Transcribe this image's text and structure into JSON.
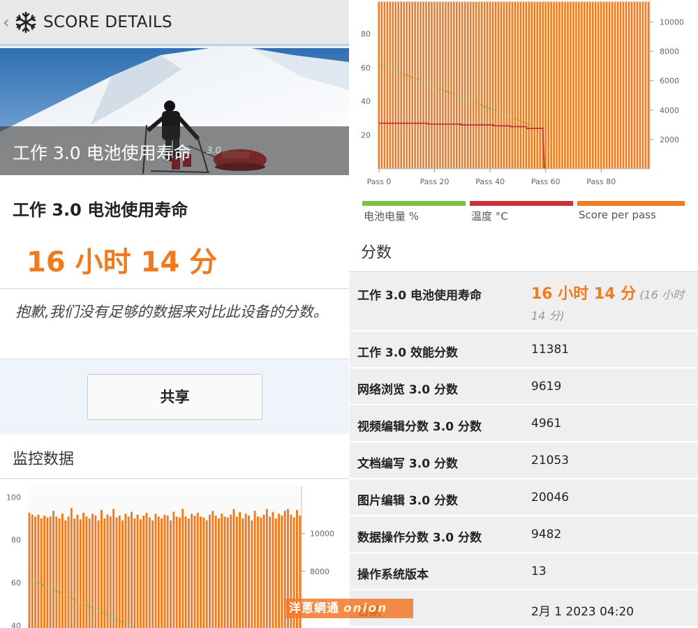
{
  "topbar": {
    "back_icon": "chevron-left-icon",
    "logo_icon": "snowflake-icon",
    "title": "SCORE DETAILS"
  },
  "hero": {
    "title": "工作 3.0 电池使用寿命",
    "version": "3.0"
  },
  "result": {
    "title": "工作 3.0 电池使用寿命",
    "value": "16 小时 14 分"
  },
  "message": "抱歉,我们没有足够的数据来对比此设备的分数。",
  "share_label": "共享",
  "monitoring": {
    "title": "监控数据"
  },
  "legend": [
    {
      "label": "电池电量 %",
      "color": "#7cc242"
    },
    {
      "label": "温度 °C",
      "color": "#c8323a"
    },
    {
      "label": "Score per pass",
      "color": "#f07b1f"
    }
  ],
  "scores": {
    "title": "分数",
    "rows": [
      {
        "label": "工作 3.0 电池使用寿命",
        "value": "16 小时 14 分",
        "sub": "(16 小时 14 分)"
      },
      {
        "label": "工作 3.0 效能分数",
        "value": "11381"
      },
      {
        "label": "网络浏览 3.0 分数",
        "value": "9619"
      },
      {
        "label": "视频编辑分数 3.0 分数",
        "value": "4961"
      },
      {
        "label": "文档编写 3.0 分数",
        "value": "21053"
      },
      {
        "label": "图片编辑 3.0 分数",
        "value": "20046"
      },
      {
        "label": "数据操作分数 3.0 分数",
        "value": "9482"
      },
      {
        "label": "操作系统版本",
        "value": "13"
      },
      {
        "label": "日期",
        "value": "2月 1 2023 04:20"
      }
    ]
  },
  "watermark": {
    "text": "洋蔥網通",
    "logo": "onion"
  },
  "chart_data": [
    {
      "type": "bar",
      "x_tick_labels": [
        "Pass 0",
        "Pass 20",
        "Pass 40",
        "Pass 60",
        "Pass 80"
      ],
      "left_ticks": [
        20,
        40,
        60,
        80
      ],
      "right_ticks": [
        2000,
        4000,
        6000,
        8000,
        10000
      ],
      "ylim_left": [
        0,
        100
      ],
      "ylim_right": [
        0,
        11500
      ],
      "score_level": 11381,
      "battery_start": 62,
      "battery_end": 23,
      "drop_pass": 59,
      "temperature": [
        27,
        27,
        27,
        26.5,
        26.5,
        26,
        26,
        25.5,
        25,
        24
      ],
      "series_names": [
        "电池电量 %",
        "温度 °C",
        "Score per pass"
      ]
    },
    {
      "type": "bar",
      "left_ticks": [
        40,
        60,
        80,
        100
      ],
      "right_ticks": [
        6000,
        8000,
        10000
      ],
      "ylim_left": [
        30,
        105
      ],
      "ylim_right": [
        4000,
        12500
      ],
      "battery_start": 62,
      "score_per_pass": [
        11100,
        11000,
        10900,
        11000,
        10800,
        10950,
        10850,
        10900,
        11200,
        10900,
        10800,
        11050,
        10700,
        10900,
        11350,
        10800,
        11000,
        10750,
        11100,
        10900,
        10800,
        11050,
        10950,
        10700,
        11250,
        10800,
        11000,
        10900,
        11300,
        10850,
        10950,
        10700,
        11050,
        10900,
        11150,
        10800,
        11000,
        10750,
        10950,
        11100,
        10850,
        10700,
        11050,
        10900,
        10800,
        11000,
        10950,
        10700,
        11150,
        10900,
        10850,
        11300,
        10900,
        10800,
        11050,
        10950,
        11100,
        10900,
        10850,
        10700,
        11000,
        11200,
        10950,
        10800,
        11050,
        10900,
        10850,
        11000,
        11300,
        10900,
        11150,
        10800,
        11050,
        10950,
        10700,
        11200,
        10900,
        10850,
        11000,
        11300,
        10900,
        11150,
        10800,
        11050,
        10950,
        11200,
        11300,
        11000,
        10850,
        11250,
        10950
      ]
    }
  ]
}
